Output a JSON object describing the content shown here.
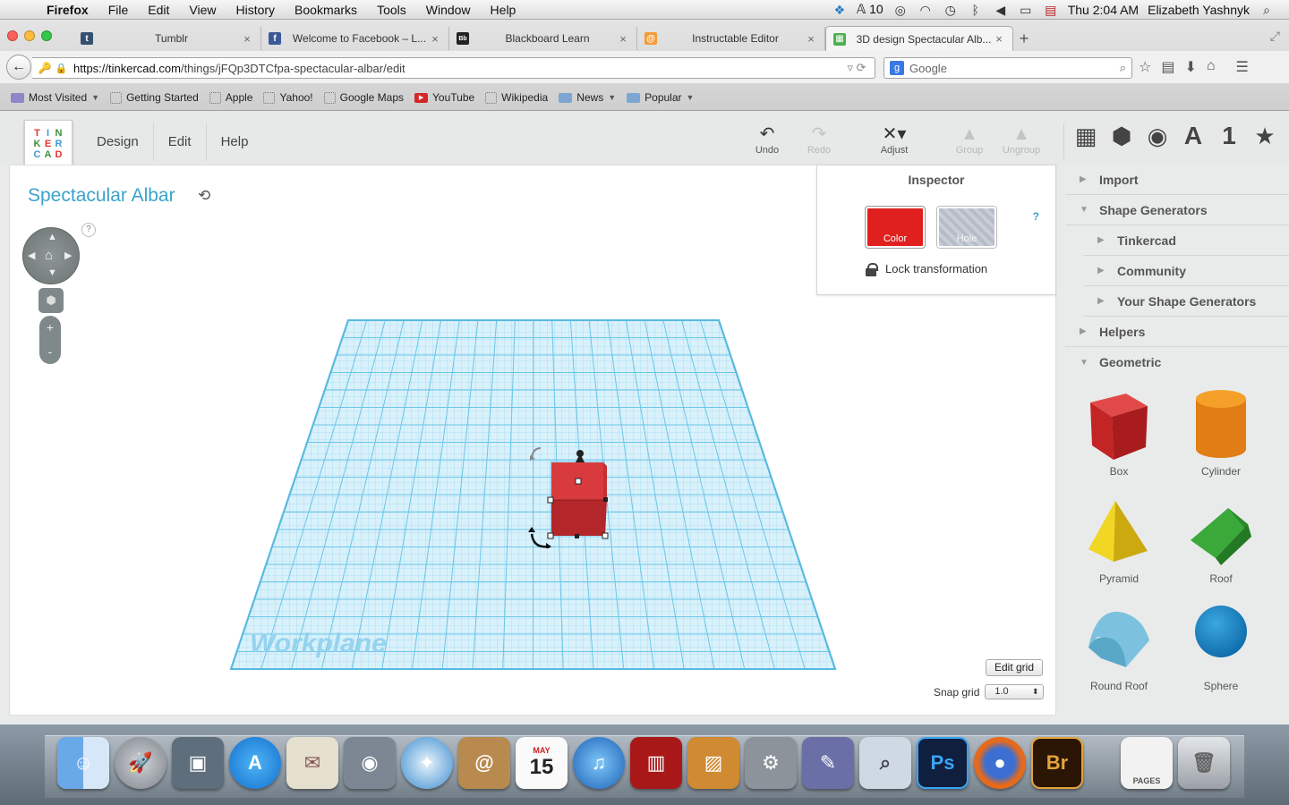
{
  "menubar": {
    "app": "Firefox",
    "items": [
      "File",
      "Edit",
      "View",
      "History",
      "Bookmarks",
      "Tools",
      "Window",
      "Help"
    ],
    "badge_count": "10",
    "clock": "Thu 2:04 AM",
    "user": "Elizabeth Yashnyk"
  },
  "tabs": [
    {
      "label": "Tumblr",
      "fav": "t",
      "color": "#34526f"
    },
    {
      "label": "Welcome to Facebook – L...",
      "fav": "f",
      "color": "#3b5998"
    },
    {
      "label": "Blackboard Learn",
      "fav": "Bb",
      "color": "#222222"
    },
    {
      "label": "Instructable Editor",
      "fav": "@",
      "color": "#f39c3a"
    },
    {
      "label": "3D design Spectacular Alb...",
      "fav": "▦",
      "color": "#4caf50"
    }
  ],
  "address": {
    "url_domain": "https://tinkercad.com",
    "url_path": "/things/jFQp3DTCfpa-spectacular-albar/edit",
    "search_placeholder": "Google"
  },
  "bookmarks": [
    "Most Visited",
    "Getting Started",
    "Apple",
    "Yahoo!",
    "Google Maps",
    "YouTube",
    "Wikipedia",
    "News",
    "Popular"
  ],
  "app": {
    "logo": [
      "T",
      "I",
      "N",
      "K",
      "E",
      "R",
      "C",
      "A",
      "D"
    ],
    "menu": [
      "Design",
      "Edit",
      "Help"
    ],
    "toolbar": {
      "undo": "Undo",
      "redo": "Redo",
      "adjust": "Adjust",
      "group": "Group",
      "ungroup": "Ungroup"
    },
    "right_icons": [
      "workplane-icon",
      "box-icon",
      "sphere-icon",
      "text-icon",
      "number-icon",
      "favorite-icon"
    ],
    "right_text": {
      "letter": "A",
      "number": "1"
    }
  },
  "design_title": "Spectacular Albar",
  "workplane_label": "Workplane",
  "inspector": {
    "title": "Inspector",
    "color_label": "Color",
    "hole_label": "Hole",
    "help": "?",
    "lock_label": "Lock transformation",
    "selected_color": "#e0201f"
  },
  "grid": {
    "edit_label": "Edit grid",
    "snap_label": "Snap grid",
    "snap_value": "1.0"
  },
  "panel": {
    "sections": [
      {
        "label": "Import",
        "level": 1,
        "expanded": false
      },
      {
        "label": "Shape Generators",
        "level": 1,
        "expanded": true
      },
      {
        "label": "Tinkercad",
        "level": 2,
        "expanded": false
      },
      {
        "label": "Community",
        "level": 2,
        "expanded": false
      },
      {
        "label": "Your Shape Generators",
        "level": 2,
        "expanded": false
      },
      {
        "label": "Helpers",
        "level": 1,
        "expanded": false
      },
      {
        "label": "Geometric",
        "level": 1,
        "expanded": true
      }
    ],
    "shapes": [
      "Box",
      "Cylinder",
      "Pyramid",
      "Roof",
      "Round Roof",
      "Sphere"
    ]
  },
  "dock": [
    "Finder",
    "Launchpad",
    "Photo Browser",
    "App Store",
    "Mail",
    "FaceTime",
    "Safari",
    "Contacts",
    "Calendar",
    "iTunes",
    "Photo Booth",
    "iPhoto",
    "System Preferences",
    "Xcode",
    "Preview",
    "Ps",
    "Firefox",
    "Br",
    "PAGES",
    "Trash"
  ],
  "calendar": {
    "month": "MAY",
    "day": "15"
  },
  "dock_labels": {
    "ps": "Ps",
    "br": "Br",
    "pages": "PAGES"
  }
}
